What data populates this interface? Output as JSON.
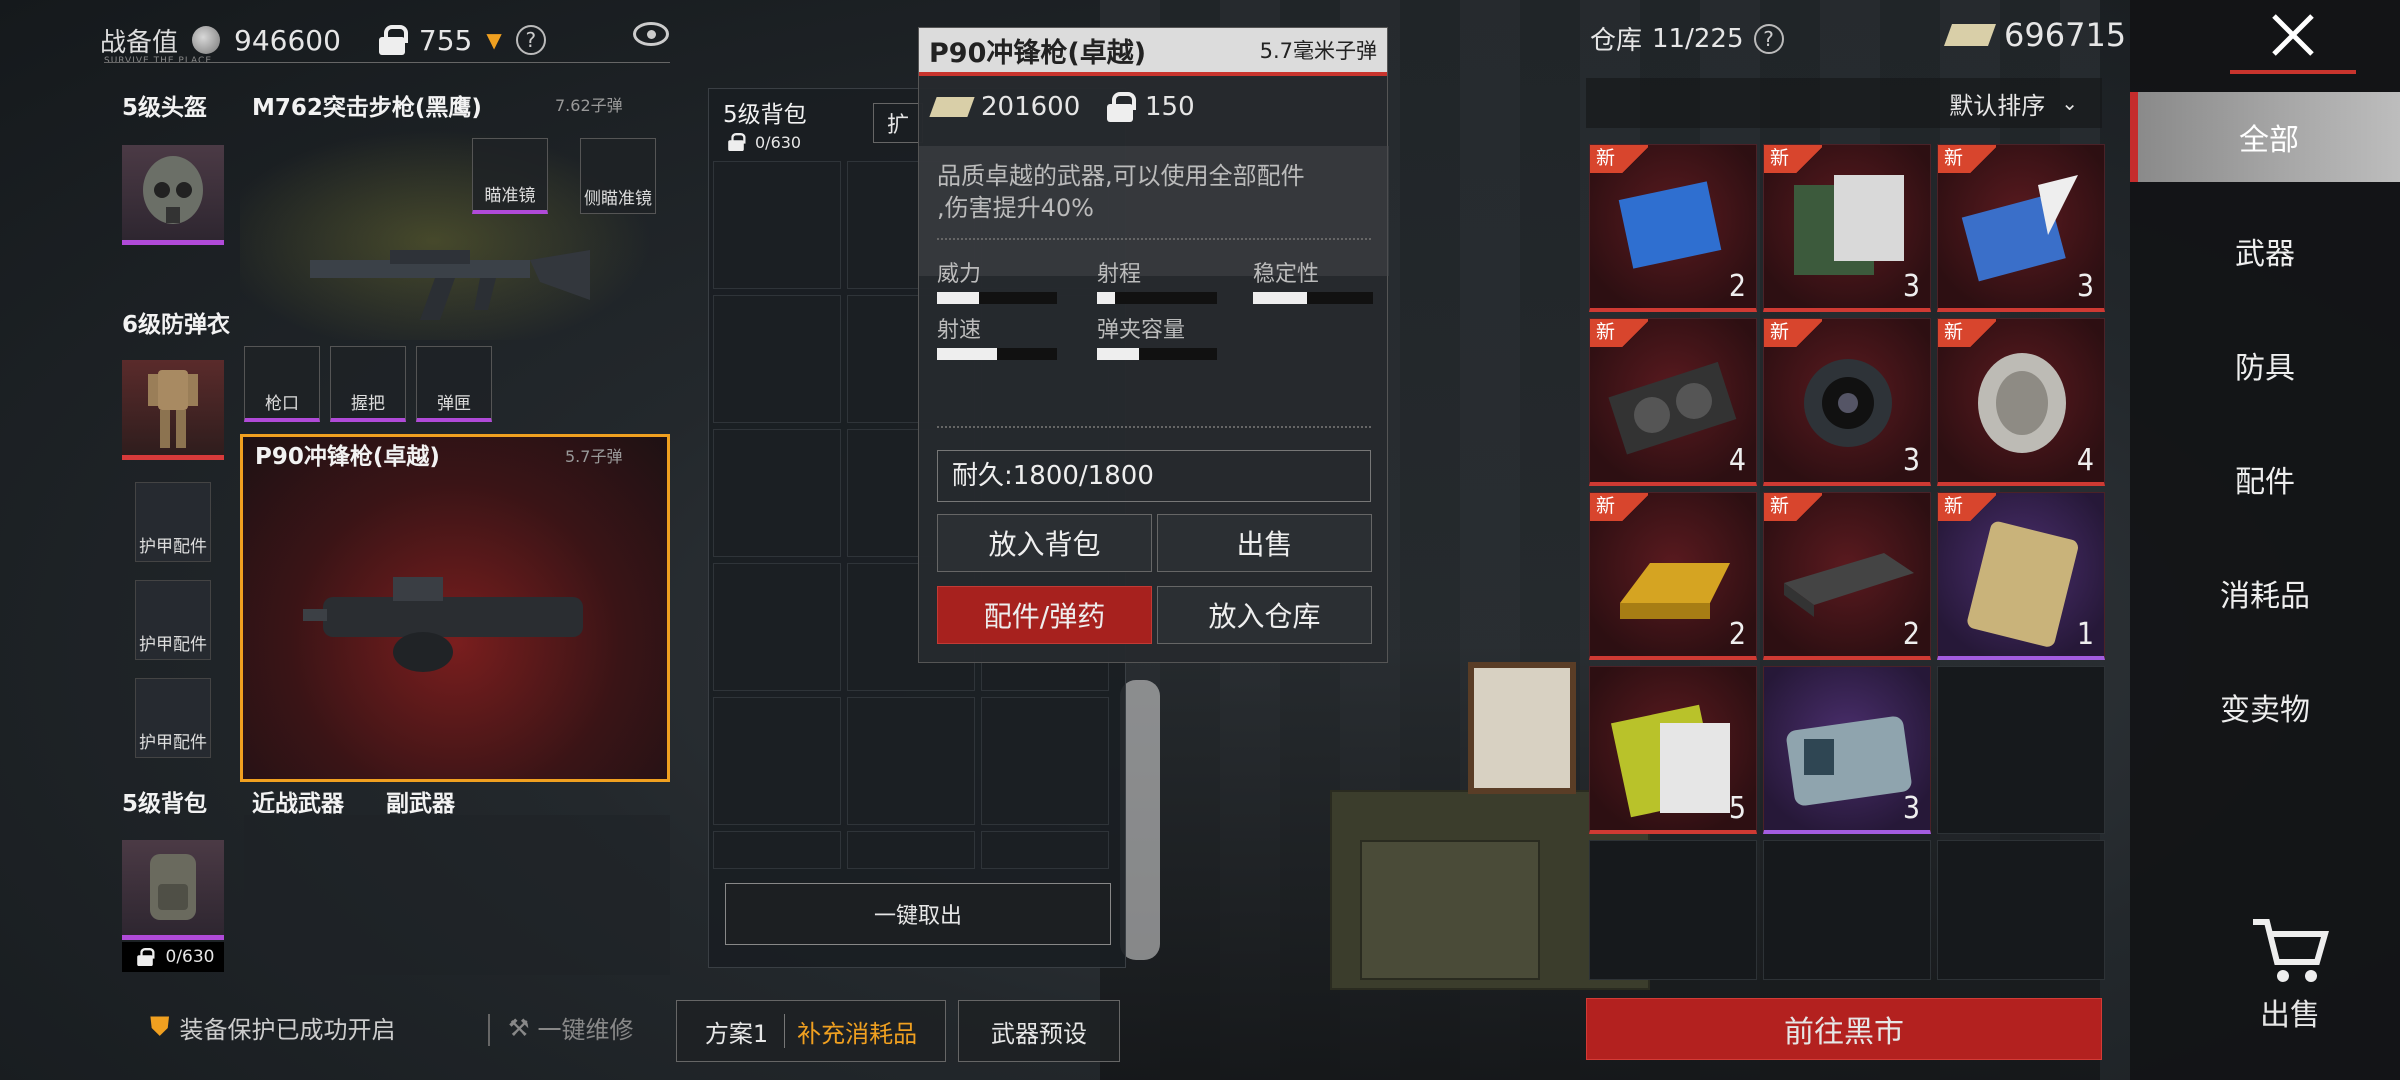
{
  "topbar": {
    "combat_value_label": "战备值",
    "combat_value": "946600",
    "locked_value": "755",
    "brand_sub": "SURVIVE THE PLACE"
  },
  "loadout": {
    "helmet_label": "5级头盔",
    "armor_label": "6级防弹衣",
    "backpack_label": "5级背包",
    "backpack_capacity": "0/630",
    "armor_slots": [
      "护甲配件",
      "护甲配件",
      "护甲配件"
    ],
    "primary": {
      "name": "M762突击步枪(黑鹰)",
      "ammo": "7.62子弹",
      "attachments": [
        "瞄准镜",
        "侧瞄准镜"
      ],
      "lower_attachments": [
        "枪口",
        "握把",
        "弹匣"
      ]
    },
    "secondary": {
      "name": "P90冲锋枪(卓越)",
      "ammo": "5.7子弹"
    },
    "melee_label": "近战武器",
    "sidearm_label": "副武器"
  },
  "backpack_panel": {
    "title": "5级背包",
    "capacity": "0/630",
    "expand_label": "扩",
    "take_all_label": "一键取出"
  },
  "popup": {
    "title": "P90冲锋枪(卓越)",
    "ammo": "5.7毫米子弹",
    "price": "201600",
    "lock_value": "150",
    "desc_line1": "品质卓越的武器,可以使用全部配件",
    "desc_line2": ",伤害提升40%",
    "stats": [
      {
        "label": "威力",
        "value": 0.35
      },
      {
        "label": "射程",
        "value": 0.15
      },
      {
        "label": "稳定性",
        "value": 0.45
      },
      {
        "label": "射速",
        "value": 0.5
      },
      {
        "label": "弹夹容量",
        "value": 0.35
      }
    ],
    "durability": "耐久:1800/1800",
    "btn_put_backpack": "放入背包",
    "btn_sell": "出售",
    "btn_attach": "配件/弹药",
    "btn_put_warehouse": "放入仓库"
  },
  "warehouse": {
    "title": "仓库",
    "capacity": "11/225",
    "money": "696715",
    "sort_label": "默认排序",
    "new_label": "新",
    "items": [
      {
        "name": "blue-cloth",
        "count": "2",
        "rarity": "red",
        "is_new": true
      },
      {
        "name": "documents",
        "count": "3",
        "rarity": "red",
        "is_new": true
      },
      {
        "name": "blueprint-feather",
        "count": "3",
        "rarity": "red",
        "is_new": true
      },
      {
        "name": "graphics-card",
        "count": "4",
        "rarity": "red",
        "is_new": true
      },
      {
        "name": "camera-lens",
        "count": "3",
        "rarity": "red",
        "is_new": true
      },
      {
        "name": "ancient-coin",
        "count": "4",
        "rarity": "red",
        "is_new": true
      },
      {
        "name": "gold-bar",
        "count": "2",
        "rarity": "red",
        "is_new": true
      },
      {
        "name": "network-switch",
        "count": "2",
        "rarity": "red",
        "is_new": true
      },
      {
        "name": "card",
        "count": "1",
        "rarity": "purple",
        "is_new": true
      },
      {
        "name": "gold-card",
        "count": "5",
        "rarity": "red",
        "is_new": false
      },
      {
        "name": "id-card",
        "count": "3",
        "rarity": "purple",
        "is_new": false
      }
    ],
    "black_market_label": "前往黑市"
  },
  "nav": {
    "items": [
      "全部",
      "武器",
      "防具",
      "配件",
      "消耗品",
      "变卖物"
    ],
    "sell_label": "出售"
  },
  "bottom": {
    "protect_text": "装备保护已成功开启",
    "repair_text": "一键维修",
    "plan_label": "方案1",
    "refill_label": "补充消耗品",
    "preset_label": "武器预设"
  },
  "colors": {
    "accent_red": "#c8342d",
    "orange": "#f0a020",
    "purple": "#b04ad8"
  }
}
